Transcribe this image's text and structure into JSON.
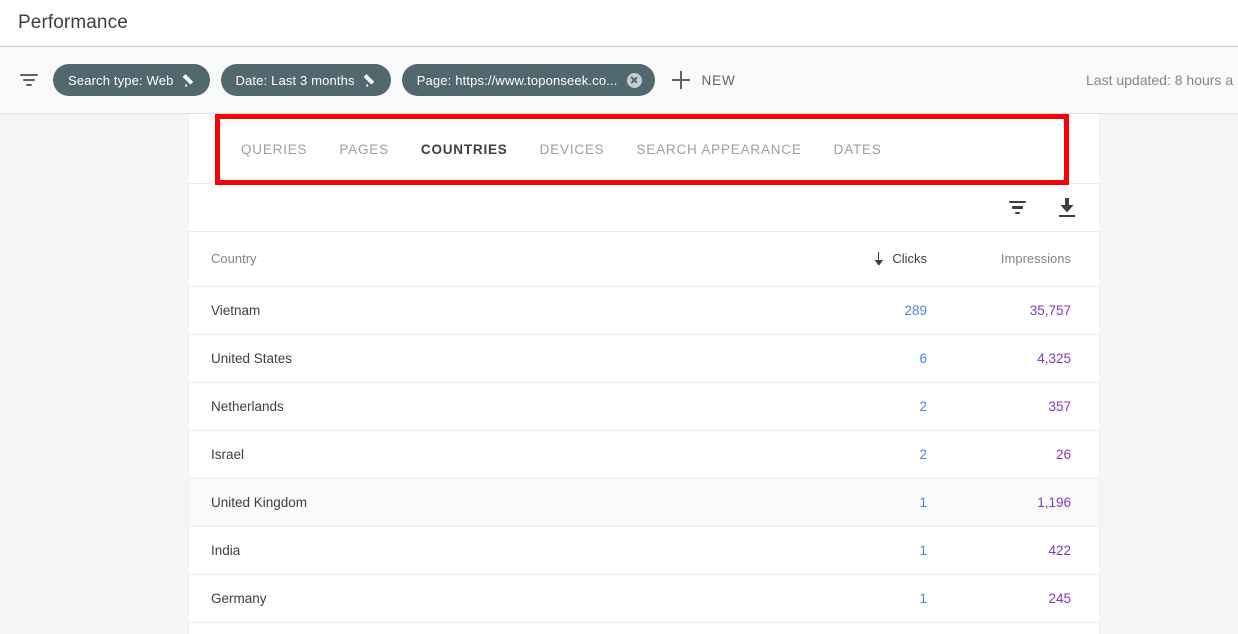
{
  "titlebar": {
    "title": "Performance"
  },
  "filterbar": {
    "tune_icon": "tune-icon",
    "chips": [
      {
        "label": "Search type: Web",
        "action_icon": "pencil-icon"
      },
      {
        "label": "Date: Last 3 months",
        "action_icon": "pencil-icon"
      },
      {
        "label": "Page: https://www.toponseek.co...",
        "action_icon": "close-icon"
      }
    ],
    "new_button": {
      "icon": "plus-icon",
      "label": "NEW"
    },
    "last_updated": "Last updated: 8 hours a"
  },
  "tabs": [
    {
      "label": "QUERIES",
      "active": false
    },
    {
      "label": "PAGES",
      "active": false
    },
    {
      "label": "COUNTRIES",
      "active": true
    },
    {
      "label": "DEVICES",
      "active": false
    },
    {
      "label": "SEARCH APPEARANCE",
      "active": false
    },
    {
      "label": "DATES",
      "active": false
    }
  ],
  "table_toolbar": {
    "filter_icon": "filter-icon",
    "download_icon": "download-icon"
  },
  "table": {
    "columns": {
      "country": "Country",
      "clicks": "Clicks",
      "impressions": "Impressions"
    },
    "sorted_by": "Clicks",
    "sort_direction": "descending",
    "rows": [
      {
        "country": "Vietnam",
        "clicks": "289",
        "impressions": "35,757",
        "hovered": false
      },
      {
        "country": "United States",
        "clicks": "6",
        "impressions": "4,325",
        "hovered": false
      },
      {
        "country": "Netherlands",
        "clicks": "2",
        "impressions": "357",
        "hovered": false
      },
      {
        "country": "Israel",
        "clicks": "2",
        "impressions": "26",
        "hovered": false
      },
      {
        "country": "United Kingdom",
        "clicks": "1",
        "impressions": "1,196",
        "hovered": true
      },
      {
        "country": "India",
        "clicks": "1",
        "impressions": "422",
        "hovered": false
      },
      {
        "country": "Germany",
        "clicks": "1",
        "impressions": "245",
        "hovered": false
      }
    ]
  },
  "annotation": {
    "type": "red-rectangle-highlight",
    "target": "tabs-bar",
    "color": "#fb0007"
  },
  "colors": {
    "chip_background": "#50686e",
    "clicks_text": "#4285f4",
    "impressions_text": "#8338c5",
    "active_tab_underline": "#5f6368",
    "page_background": "#f5f5f5"
  }
}
